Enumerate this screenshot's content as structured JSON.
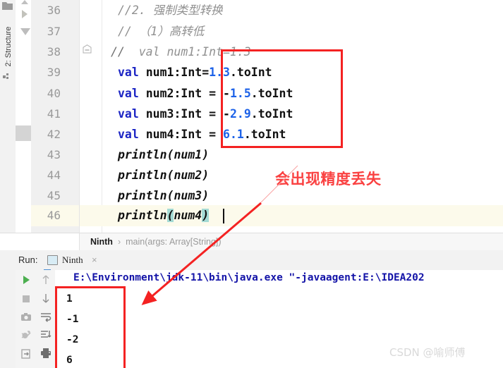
{
  "window": {
    "app": "IntelliJ IDEA",
    "watermark": "CSDN @喻师傅"
  },
  "sidebar": {
    "structure_tab_label": "2: Structure",
    "icons": [
      {
        "name": "folder-icon"
      },
      {
        "name": "grid-icon"
      }
    ]
  },
  "editor": {
    "line_numbers": [
      "36",
      "37",
      "38",
      "39",
      "40",
      "41",
      "42",
      "43",
      "44",
      "45",
      "46"
    ],
    "highlighted_line": "46",
    "lines": [
      {
        "number": "36",
        "segments": [
          {
            "text": "//2. 强制类型转换",
            "style": "cmt"
          }
        ]
      },
      {
        "number": "37",
        "segments": [
          {
            "text": "// （1）高转低",
            "style": "cmt"
          }
        ]
      },
      {
        "number": "38",
        "segments": [
          {
            "text": "  val num1:Int=1.3",
            "style": "cmt"
          }
        ]
      },
      {
        "number": "39",
        "segments": [
          {
            "text": "val ",
            "style": "kw"
          },
          {
            "text": "num1:Int=",
            "style": "plain"
          },
          {
            "text": "1.3",
            "style": "num"
          },
          {
            "text": ".toInt",
            "style": "plain"
          }
        ]
      },
      {
        "number": "40",
        "segments": [
          {
            "text": "val ",
            "style": "kw"
          },
          {
            "text": "num2:Int = -",
            "style": "plain"
          },
          {
            "text": "1.5",
            "style": "num"
          },
          {
            "text": ".toInt",
            "style": "plain"
          }
        ]
      },
      {
        "number": "41",
        "segments": [
          {
            "text": "val ",
            "style": "kw"
          },
          {
            "text": "num3:Int = -",
            "style": "plain"
          },
          {
            "text": "2.9",
            "style": "num"
          },
          {
            "text": ".toInt",
            "style": "plain"
          }
        ]
      },
      {
        "number": "42",
        "segments": [
          {
            "text": "val ",
            "style": "kw"
          },
          {
            "text": "num4:Int = ",
            "style": "plain"
          },
          {
            "text": "6.1",
            "style": "num"
          },
          {
            "text": ".toInt",
            "style": "plain"
          }
        ]
      },
      {
        "number": "43",
        "segments": [
          {
            "text": "println(num1)",
            "style": "ital"
          }
        ]
      },
      {
        "number": "44",
        "segments": [
          {
            "text": "println(num2)",
            "style": "ital"
          }
        ]
      },
      {
        "number": "45",
        "segments": [
          {
            "text": "println(num3)",
            "style": "ital"
          }
        ]
      },
      {
        "number": "46",
        "segments": [
          {
            "text": "println",
            "style": "ital"
          },
          {
            "text": "(",
            "style": "ital paren-hl"
          },
          {
            "text": "num4",
            "style": "ital"
          },
          {
            "text": ")",
            "style": "ital paren-hl"
          }
        ]
      }
    ],
    "fold_comment_marker": "//"
  },
  "annotations": {
    "code_note": "会出现精度丢失",
    "note_color": "#fa4141",
    "box_color": "#f42222"
  },
  "breadcrumb": {
    "class": "Ninth",
    "separator": "›",
    "method": "main(args: Array[String])"
  },
  "run_panel": {
    "label": "Run:",
    "tab_name": "Ninth",
    "close_glyph": "×",
    "toolbar_left": [
      {
        "name": "run-icon",
        "label": "Run"
      },
      {
        "name": "stop-icon",
        "label": "Stop"
      },
      {
        "name": "camera-icon",
        "label": "Snapshot"
      },
      {
        "name": "debug-icon",
        "label": "Rerun Debug"
      },
      {
        "name": "export-icon",
        "label": "Export"
      }
    ],
    "toolbar_right": [
      {
        "name": "arrow-up-icon",
        "label": "Up"
      },
      {
        "name": "arrow-down-icon",
        "label": "Down"
      },
      {
        "name": "soft-wrap-icon",
        "label": "Soft-Wrap"
      },
      {
        "name": "scroll-end-icon",
        "label": "Scroll to End"
      },
      {
        "name": "print-icon",
        "label": "Print"
      }
    ],
    "console": {
      "command_line": "E:\\Environment\\jdk-11\\bin\\java.exe \"-javaagent:E:\\IDEA202",
      "output": [
        "1",
        "-1",
        "-2",
        "6"
      ]
    }
  }
}
